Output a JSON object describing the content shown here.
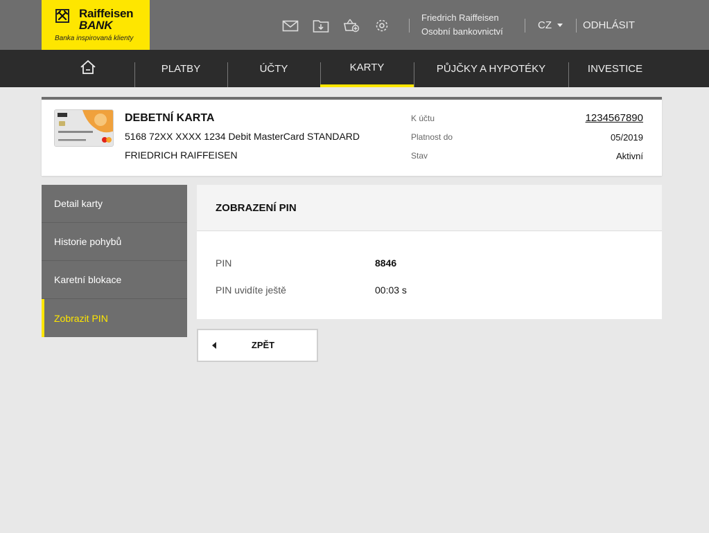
{
  "brand": {
    "name_line1": "Raiffeisen",
    "name_line2": "BANK",
    "tagline": "Banka inspirovaná klienty",
    "color_primary": "#fee600",
    "color_dark": "#2c2c2c",
    "color_header": "#6e6e6e"
  },
  "header": {
    "icons": [
      "mail-icon",
      "download-folder-icon",
      "basket-add-icon",
      "settings-icon"
    ],
    "user_name": "Friedrich Raiffeisen",
    "user_subtitle": "Osobní bankovnictví",
    "language": "CZ",
    "logout_label": "ODHLÁSIT"
  },
  "nav": {
    "home_icon": "home-icon",
    "items": [
      {
        "label": "PLATBY",
        "active": false
      },
      {
        "label": "ÚČTY",
        "active": false
      },
      {
        "label": "KARTY",
        "active": true
      },
      {
        "label": "PŮJČKY A HYPOTÉKY",
        "active": false
      },
      {
        "label": "INVESTICE",
        "active": false
      }
    ]
  },
  "card": {
    "title": "DEBETNÍ KARTA",
    "number_line": "5168 72XX XXXX 1234 Debit MasterCard STANDARD",
    "holder": "FRIEDRICH RAIFFEISEN",
    "account_label": "K účtu",
    "account_value": "1234567890",
    "validity_label": "Platnost do",
    "validity_value": "05/2019",
    "status_label": "Stav",
    "status_value": "Aktivní"
  },
  "sidebar": {
    "items": [
      {
        "label": "Detail karty",
        "active": false
      },
      {
        "label": "Historie pohybů",
        "active": false
      },
      {
        "label": "Karetní blokace",
        "active": false
      },
      {
        "label": "Zobrazit PIN",
        "active": true
      }
    ]
  },
  "panel": {
    "title": "ZOBRAZENÍ PIN",
    "rows": [
      {
        "label": "PIN",
        "value": "8846"
      },
      {
        "label": "PIN uvidíte ještě",
        "value": "00:03 s"
      }
    ]
  },
  "back_button": {
    "label": "ZPĚT"
  }
}
